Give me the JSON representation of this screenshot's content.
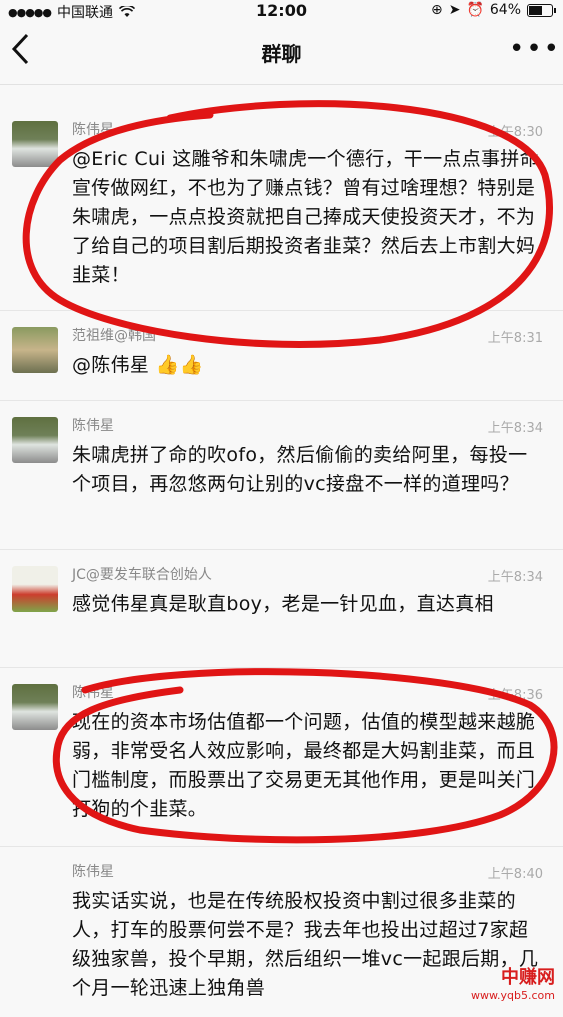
{
  "status": {
    "carrier": "中国联通",
    "time": "12:00",
    "battery_text": "64%",
    "battery_level": 0.64
  },
  "nav": {
    "back_icon": "chevron-left-icon",
    "title": "群聊",
    "more_icon": "more-dots-icon"
  },
  "messages": [
    {
      "sender": "陈伟星",
      "time": "上午8:30",
      "text": "@Eric Cui 这雕爷和朱啸虎一个德行，干一点点事拼命宣传做网红，不也为了赚点钱？曾有过啥理想？特别是朱啸虎，一点点投资就把自己捧成天使投资天才，不为了给自己的项目割后期投资者韭菜？然后去上市割大妈韭菜！"
    },
    {
      "sender": "范祖维@韩国",
      "time": "上午8:31",
      "text": "@陈伟星 👍👍"
    },
    {
      "sender": "陈伟星",
      "time": "上午8:34",
      "text": "朱啸虎拼了命的吹ofo，然后偷偷的卖给阿里，每投一个项目，再忽悠两句让别的vc接盘不一样的道理吗？"
    },
    {
      "sender": "JC@要发车联合创始人",
      "time": "上午8:34",
      "text": "感觉伟星真是耿直boy，老是一针见血，直达真相"
    },
    {
      "sender": "陈伟星",
      "time": "上午8:36",
      "text": "现在的资本市场估值都一个问题，估值的模型越来越脆弱，非常受名人效应影响，最终都是大妈割韭菜，而且门槛制度，而股票出了交易更无其他作用，更是叫关门打狗的个韭菜。"
    },
    {
      "sender": "陈伟星",
      "time": "上午8:40",
      "text": "我实话实说，也是在传统股权投资中割过很多韭菜的人，打车的股票何尝不是？我去年也投出过超过7家超级独家兽，投个早期，然后组织一堆vc一起跟后期，几个月一轮迅速上独角兽"
    }
  ],
  "watermark": {
    "line1": "中赚网",
    "line2": "www.yqb5.com"
  },
  "colors": {
    "annotation_red": "#e01515",
    "watermark_red": "#d81e1e"
  }
}
